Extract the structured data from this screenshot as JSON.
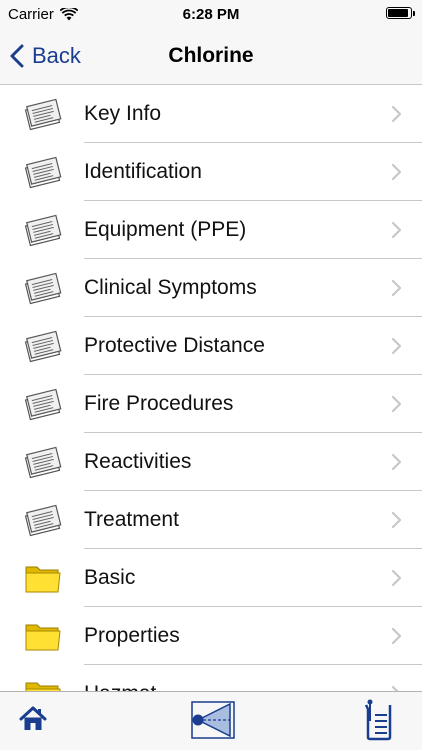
{
  "status_bar": {
    "carrier": "Carrier",
    "time": "6:28 PM",
    "battery_level": 1.0
  },
  "nav": {
    "back_label": "Back",
    "title": "Chlorine"
  },
  "list": {
    "items": [
      {
        "label": "Key Info",
        "icon": "document-icon"
      },
      {
        "label": "Identification",
        "icon": "document-icon"
      },
      {
        "label": "Equipment (PPE)",
        "icon": "document-icon"
      },
      {
        "label": "Clinical Symptoms",
        "icon": "document-icon"
      },
      {
        "label": "Protective Distance",
        "icon": "document-icon"
      },
      {
        "label": "Fire Procedures",
        "icon": "document-icon"
      },
      {
        "label": "Reactivities",
        "icon": "document-icon"
      },
      {
        "label": "Treatment",
        "icon": "document-icon"
      },
      {
        "label": "Basic",
        "icon": "folder-icon"
      },
      {
        "label": "Properties",
        "icon": "folder-icon"
      },
      {
        "label": "Hazmat",
        "icon": "folder-icon"
      }
    ]
  },
  "tab_bar": {
    "tabs": [
      {
        "icon": "home-icon"
      },
      {
        "icon": "protective-distance-icon"
      },
      {
        "icon": "beaker-icon"
      }
    ]
  },
  "colors": {
    "accent": "#1a3d8f",
    "separator": "#c8c7cc",
    "bar_background": "#f7f7f7"
  }
}
